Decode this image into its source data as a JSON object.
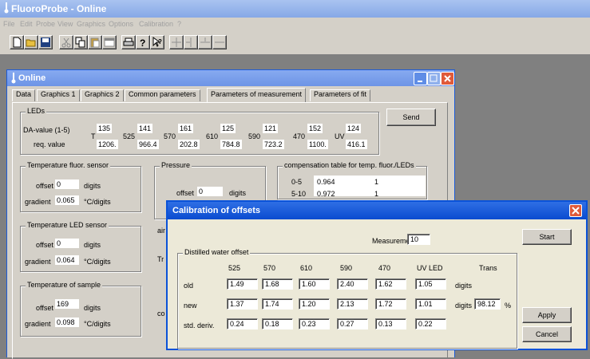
{
  "app": {
    "title": "FluoroProbe - Online",
    "menu": [
      "File",
      "Edit",
      "Probe",
      "View",
      "Graphics",
      "Options",
      "Calibration",
      "?"
    ]
  },
  "online": {
    "title": "Online",
    "tabs": [
      "Data",
      "Graphics 1",
      "Graphics 2",
      "Common parameters",
      "Parameters of measurement",
      "Parameters of fit"
    ],
    "send_label": "Send",
    "leds": {
      "title": "LEDs",
      "da_label": "DA-value (1-5)",
      "req_label": "req. value",
      "columns": [
        {
          "name": "T",
          "da": "135",
          "req": "1206."
        },
        {
          "name": "525",
          "da": "141",
          "req": "966.4"
        },
        {
          "name": "570",
          "da": "161",
          "req": "202.8"
        },
        {
          "name": "610",
          "da": "125",
          "req": "784.8"
        },
        {
          "name": "590",
          "da": "121",
          "req": "723.2"
        },
        {
          "name": "470",
          "da": "152",
          "req": "1100."
        },
        {
          "name": "UV",
          "da": "124",
          "req": "416.1"
        }
      ]
    },
    "temp_fluor": {
      "title": "Temperature fluor. sensor",
      "offset_label": "offset",
      "offset": "0",
      "offset_unit": "digits",
      "gradient_label": "gradient",
      "gradient": "0.065",
      "gradient_unit": "°C/digits"
    },
    "temp_led": {
      "title": "Temperature LED sensor",
      "offset_label": "offset",
      "offset": "0",
      "offset_unit": "digits",
      "gradient_label": "gradient",
      "gradient": "0.064",
      "gradient_unit": "°C/digits"
    },
    "temp_sample": {
      "title": "Temperature of sample",
      "offset_label": "offset",
      "offset": "169",
      "offset_unit": "digits",
      "gradient_label": "gradient",
      "gradient": "0.098",
      "gradient_unit": "°C/digits"
    },
    "pressure": {
      "title": "Pressure",
      "offset_label": "offset",
      "offset": "0",
      "offset_unit": "digits",
      "air_label": "air",
      "tr_label": "Tr",
      "co_label": "co"
    },
    "comp_table": {
      "title": "compensation table for temp. fluor./LEDs",
      "rows": [
        {
          "range": "0-5",
          "v1": "0.964",
          "v2": "1"
        },
        {
          "range": "5-10",
          "v1": "0.972",
          "v2": "1"
        }
      ]
    }
  },
  "calibration": {
    "title": "Calibration of offsets",
    "measurement_label": "Measurement:",
    "measurement_value": "10",
    "group_title": "Distilled water offset",
    "columns": [
      "525",
      "570",
      "610",
      "590",
      "470",
      "UV LED",
      "Trans"
    ],
    "rows": [
      {
        "label": "old",
        "values": [
          "1.49",
          "1.68",
          "1.60",
          "2.40",
          "1.62",
          "1.05"
        ],
        "unit": "digits"
      },
      {
        "label": "new",
        "values": [
          "1.37",
          "1.74",
          "1.20",
          "2.13",
          "1.72",
          "1.01"
        ],
        "unit": "digits",
        "trans": "98.12",
        "trans_unit": "%"
      },
      {
        "label": "std. deriv.",
        "values": [
          "0.24",
          "0.18",
          "0.23",
          "0.27",
          "0.13",
          "0.22"
        ]
      }
    ],
    "start_label": "Start",
    "apply_label": "Apply",
    "cancel_label": "Cancel"
  },
  "colors": {
    "title_active": "#1c5bd8",
    "title_inactive": "#7aa0e8",
    "desktop": "#808080",
    "face": "#d4d0c8",
    "close_red": "#e05a3a"
  }
}
